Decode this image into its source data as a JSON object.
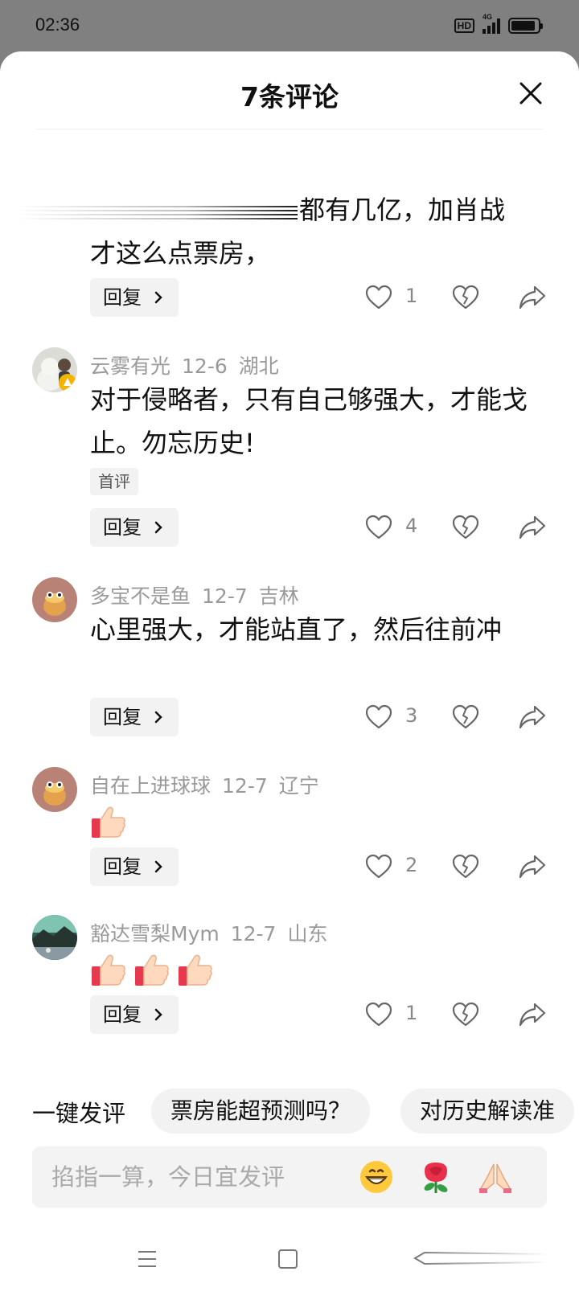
{
  "status_bar": {
    "time": "02:36",
    "hd": "HD",
    "network": "4G",
    "battery_level": 0.92
  },
  "sheet": {
    "title": "7条评论"
  },
  "comments": [
    {
      "text_line1": "都有几亿，加肖战",
      "text_line2": "才这么点票房，",
      "reply_label": "回复",
      "likes": "1"
    },
    {
      "username": "云雾有光",
      "date": "12-6",
      "location": "湖北",
      "text": "对于侵略者，只有自己够强大，才能戈止。勿忘历史!",
      "tag": "首评",
      "reply_label": "回复",
      "likes": "4"
    },
    {
      "username": "多宝不是鱼",
      "date": "12-7",
      "location": "吉林",
      "text": "心里强大，才能站直了，然后往前冲",
      "reply_label": "回复",
      "likes": "3"
    },
    {
      "username": "自在上进球球",
      "date": "12-7",
      "location": "辽宁",
      "emoji_count": 1,
      "reply_label": "回复",
      "likes": "2"
    },
    {
      "username": "豁达雪梨Mym",
      "date": "12-7",
      "location": "山东",
      "emoji_count": 3,
      "reply_label": "回复",
      "likes": "1"
    }
  ],
  "quick_comment": {
    "label": "一键发评",
    "chips": [
      "票房能超预测吗？",
      "对历史解读准"
    ]
  },
  "input": {
    "placeholder": "掐指一算，今日宜发评"
  },
  "icons": {
    "emoji_grin": "grinning-face-icon",
    "emoji_rose": "rose-icon",
    "emoji_pray": "folded-hands-icon"
  }
}
